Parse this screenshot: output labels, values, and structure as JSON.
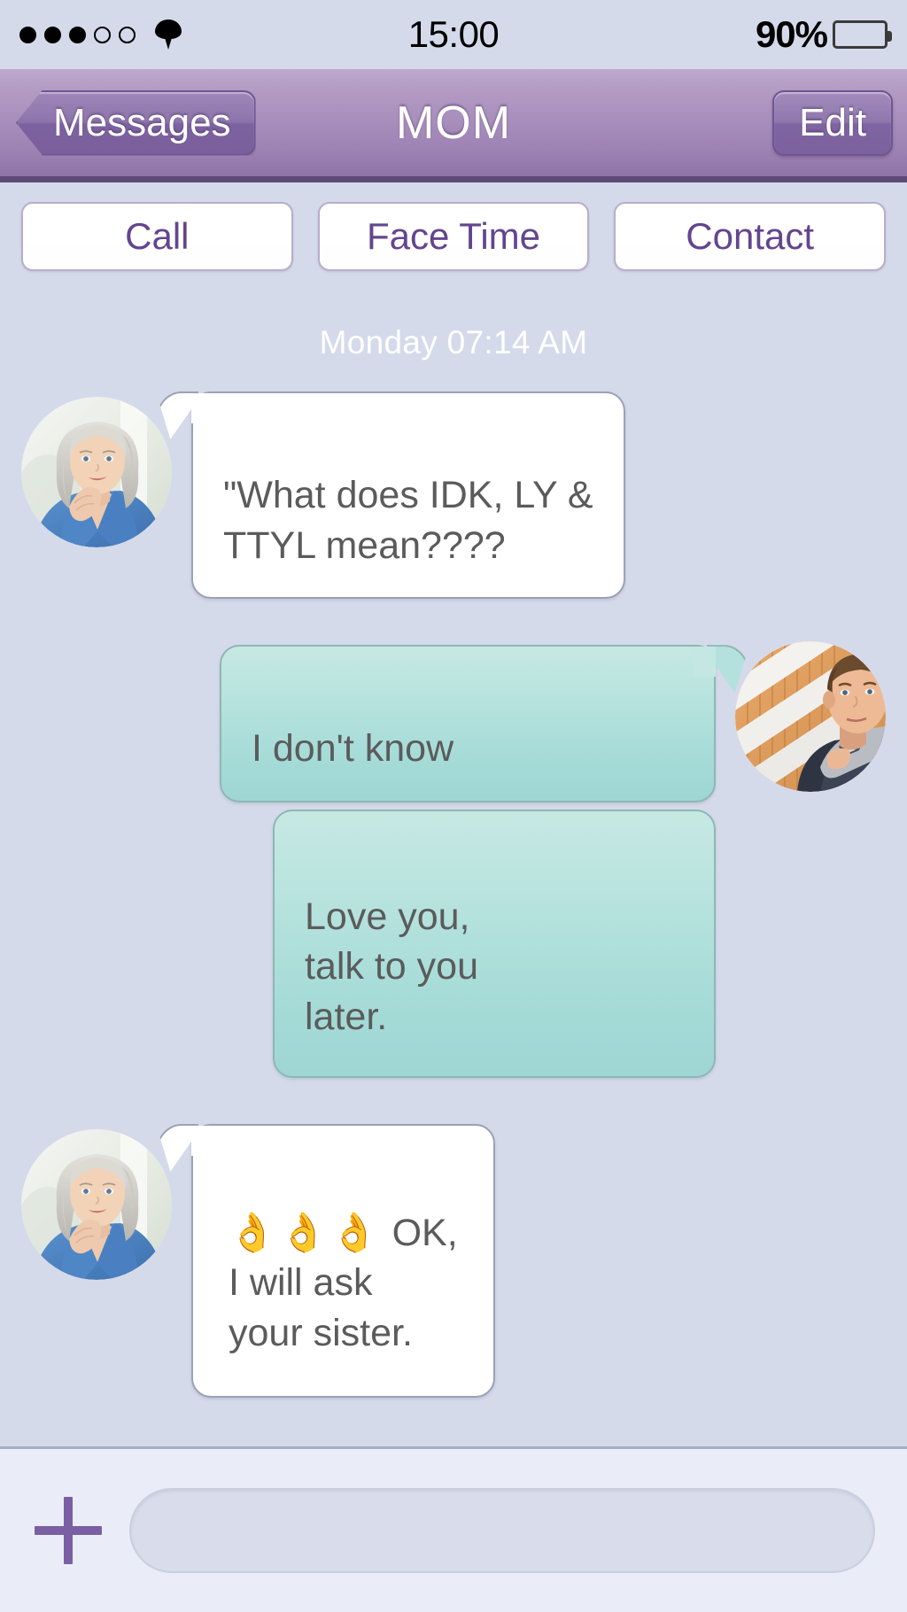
{
  "status_bar": {
    "signal_dots_filled": 3,
    "signal_dots_empty": 2,
    "wifi_icon": "wifi-icon",
    "time": "15:00",
    "battery_percent": "90%",
    "battery_level": 90
  },
  "nav_bar": {
    "back_label": "Messages",
    "title": "MOM",
    "edit_label": "Edit",
    "bar_color_top": "#bda9cc",
    "bar_color_bottom": "#8f74a7",
    "separator_color": "#5e4a78"
  },
  "actions": [
    {
      "label": "Call",
      "name": "call-button"
    },
    {
      "label": "Face Time",
      "name": "facetime-button"
    },
    {
      "label": "Contact",
      "name": "contact-button"
    }
  ],
  "conversation": {
    "timestamp": "Monday 07:14 AM",
    "messages": [
      {
        "id": "msg-1",
        "sender": "mom",
        "direction": "incoming",
        "text": "\"What does IDK, LY &\nTTYL mean????",
        "bubble_color": "#ffffff",
        "text_color": "#5b5b5b"
      },
      {
        "id": "msg-2",
        "sender": "son",
        "direction": "outgoing",
        "text": "I don't know",
        "bubble_color": "#b4e1dd",
        "text_color": "#5b5b5b"
      },
      {
        "id": "msg-3",
        "sender": "son",
        "direction": "outgoing",
        "text": "Love you,\ntalk to you\nlater.",
        "bubble_color": "#b4e1dd",
        "text_color": "#5b5b5b"
      },
      {
        "id": "msg-4",
        "sender": "mom",
        "direction": "incoming",
        "emoji": "👌👌👌",
        "text": " OK,\nI will ask\nyour sister.",
        "bubble_color": "#ffffff",
        "text_color": "#5b5b5b"
      }
    ]
  },
  "input_bar": {
    "plus_icon": "plus-icon",
    "value": "",
    "placeholder": "",
    "accent_color": "#7b5fa3"
  }
}
